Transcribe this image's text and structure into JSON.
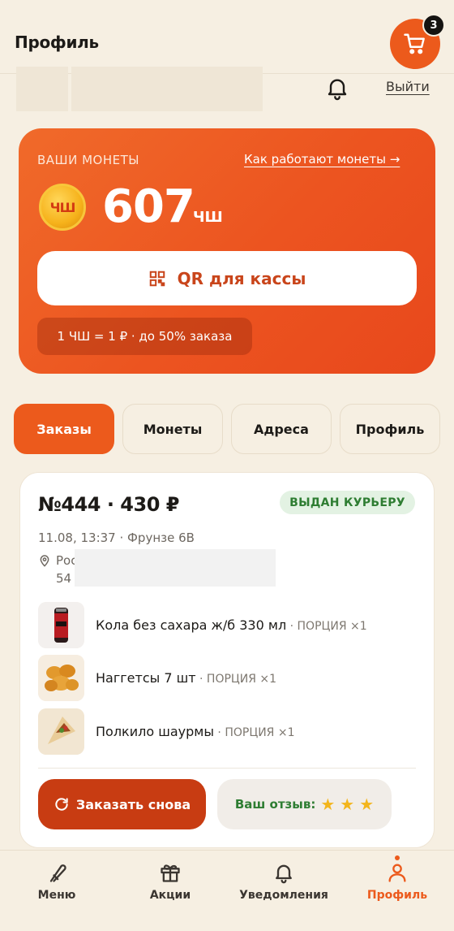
{
  "header": {
    "title": "Профиль",
    "cart_count": "3",
    "logout_label": "Выйти"
  },
  "coins": {
    "label": "ВАШИ МОНЕТЫ",
    "how_link": "Как работают монеты →",
    "coin_icon_text": "ЧШ",
    "value": "607",
    "unit": "ЧШ",
    "qr_label": "QR для кассы",
    "rate": "1 ЧШ = 1 ₽ · до 50% заказа"
  },
  "tabs": [
    {
      "label": "Заказы",
      "active": true
    },
    {
      "label": "Монеты",
      "active": false
    },
    {
      "label": "Адреса",
      "active": false
    },
    {
      "label": "Профиль",
      "active": false
    }
  ],
  "order": {
    "title": "№444 · 430 ₽",
    "status": "ВЫДАН КУРЬЕРУ",
    "meta": "11.08, 13:37 · Фрунзе 6В",
    "address_line1": "Рос",
    "address_line2": "54",
    "items": [
      {
        "name": "Кола без сахара ж/б 330 мл",
        "portion": " · ПОРЦИЯ ×1",
        "icon": "cola-can-icon"
      },
      {
        "name": "Наггетсы 7 шт",
        "portion": " · ПОРЦИЯ ×1",
        "icon": "nuggets-icon"
      },
      {
        "name": "Полкило шаурмы",
        "portion": " · ПОРЦИЯ ×1",
        "icon": "shawarma-icon"
      }
    ],
    "reorder_label": "Заказать снова",
    "review_label": "Ваш отзыв:",
    "rating": 3
  },
  "nav": [
    {
      "label": "Меню",
      "icon": "menu-icon"
    },
    {
      "label": "Акции",
      "icon": "gift-icon"
    },
    {
      "label": "Уведомления",
      "icon": "bell-icon"
    },
    {
      "label": "Профиль",
      "icon": "person-icon",
      "active": true
    }
  ],
  "colors": {
    "accent": "#ec5a1c",
    "background": "#f6efe2",
    "status_green": "#2e7d32",
    "reorder": "#c83c12"
  }
}
